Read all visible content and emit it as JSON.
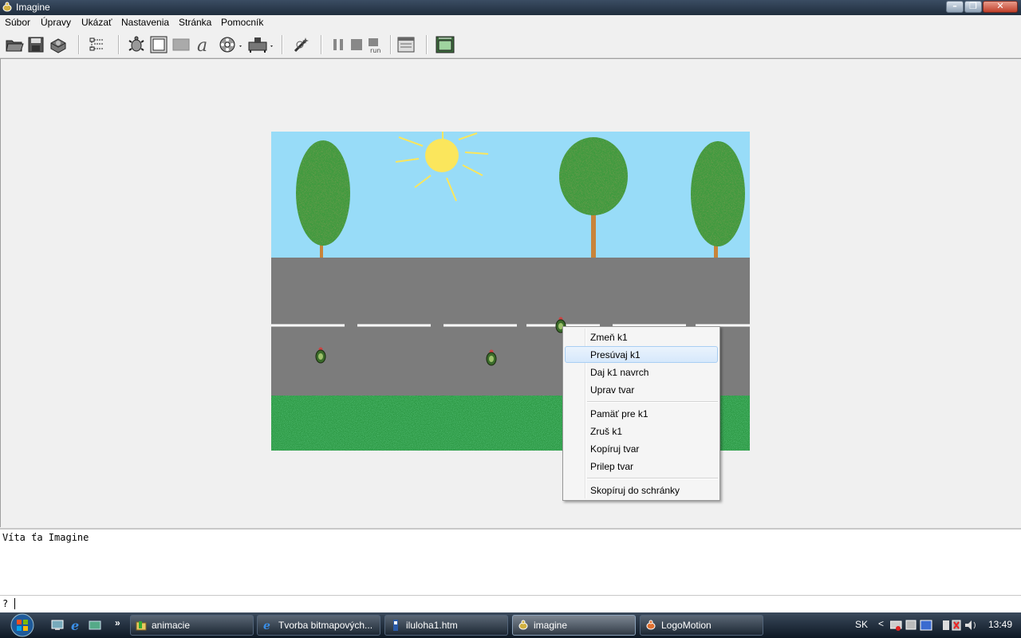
{
  "window": {
    "title": "Imagine"
  },
  "menu": [
    "Súbor",
    "Úpravy",
    "Ukázať",
    "Nastavenia",
    "Stránka",
    "Pomocník"
  ],
  "toolbar": {
    "icons": [
      "open-folder-icon",
      "save-icon",
      "print-icon",
      "tree-view-icon",
      "turtle-icon",
      "frame-icon",
      "rectangle-icon",
      "text-icon",
      "media-player-icon",
      "joystick-icon",
      "magic-wand-icon",
      "pause-icon",
      "stop-icon",
      "run-icon",
      "window-icon",
      "page-view-icon"
    ]
  },
  "context_menu": {
    "items": [
      "Zmeň k1",
      "Presúvaj k1",
      "Daj k1 navrch",
      "Uprav tvar",
      "Pamäť pre k1",
      "Zruš k1",
      "Kopíruj tvar",
      "Prilep tvar",
      "Skopíruj do schránky"
    ],
    "highlighted": "Presúvaj k1"
  },
  "output": {
    "text": "Víta ťa Imagine"
  },
  "command_line": {
    "prompt": "?",
    "value": ""
  },
  "taskbar": {
    "tasks": [
      "animacie",
      "Tvorba bitmapových...",
      "iluloha1.htm",
      "imagine",
      "LogoMotion"
    ],
    "active": "imagine",
    "quicklaunch_more": "»",
    "language": "SK",
    "clock": "13:49"
  },
  "colors": {
    "sky": "#98dcf8",
    "road": "#7c7c7c",
    "grass": "#1f8a3a",
    "sun": "#fbe65c",
    "highlight": "#d6e8fb"
  }
}
